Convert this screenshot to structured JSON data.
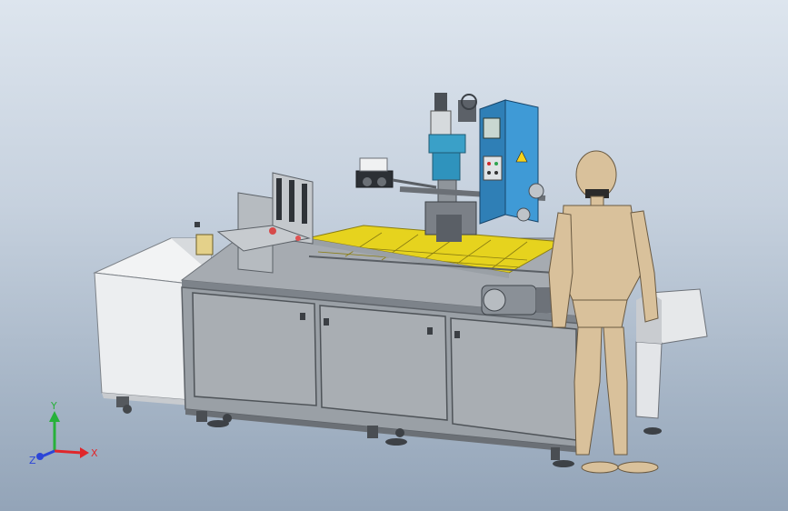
{
  "viewport": {
    "background_top": "#dde5ee",
    "background_bottom": "#93a4b8"
  },
  "model": {
    "frame_color": "#8d949c",
    "panel_color": "#a3a8ad",
    "conveyor_color": "#e8d21a",
    "control_cabinet_color": "#3f9ad6",
    "mannequin_color": "#d9c19b"
  },
  "triad": {
    "x_label": "X",
    "y_label": "Y",
    "z_label": "Z",
    "x_color": "#e0262b",
    "y_color": "#27b13a",
    "z_color": "#2c45d8"
  }
}
